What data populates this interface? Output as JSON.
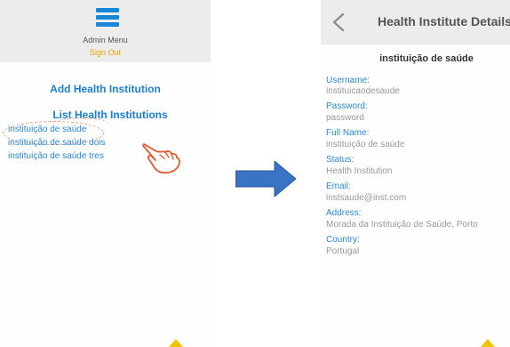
{
  "left": {
    "menu_title": "Admin Menu",
    "sign_out": "Sign Out",
    "add_institution": "Add Health Institution",
    "list_institutions": "List Health Institutions",
    "institutions": [
      "instituição de saúde",
      "instituição de saúde dois",
      "instituição de saúde tres"
    ]
  },
  "right": {
    "header_title": "Health Institute Details",
    "subtitle": "instituição de saúde",
    "fields": [
      {
        "label": "Username:",
        "value": "instituicaodesaude"
      },
      {
        "label": "Password:",
        "value": "password"
      },
      {
        "label": "Full Name:",
        "value": "instituição de saúde"
      },
      {
        "label": "Status:",
        "value": "Health Institution"
      },
      {
        "label": "Email:",
        "value": "instsaude@inst.com"
      },
      {
        "label": "Address:",
        "value": "Morada da Instituição de Saúde, Porto"
      },
      {
        "label": "Country:",
        "value": "Portugal"
      }
    ]
  },
  "colors": {
    "link_blue": "#1c7fd0",
    "accent_orange": "#f4a000",
    "annotation": "#e8a08a",
    "arrow_blue": "#3b73c4"
  },
  "icons": [
    "hamburger-icon",
    "pointing-hand-icon",
    "right-arrow-icon",
    "back-icon"
  ]
}
